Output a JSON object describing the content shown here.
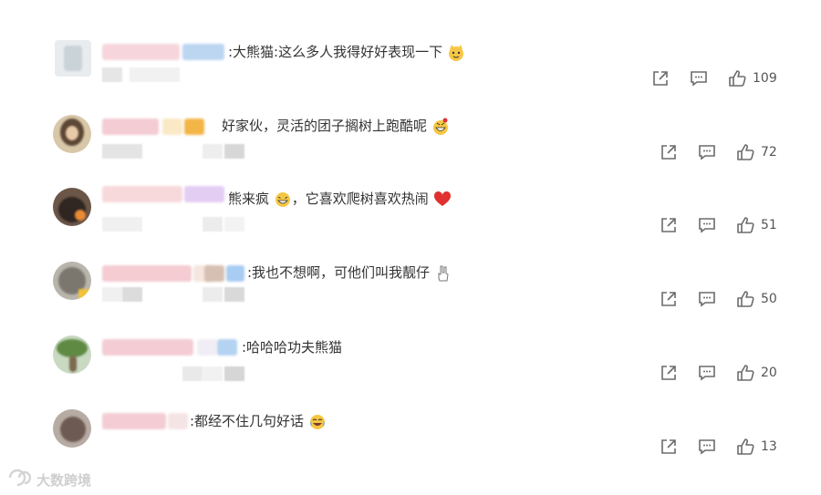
{
  "comments": [
    {
      "text": ":大熊猫:这么多人我得好好表现一下",
      "emoji": "cat-face",
      "likes": "109"
    },
    {
      "text": "好家伙，灵活的团子搁树上跑酷呢",
      "emoji": "grin-face",
      "likes": "72"
    },
    {
      "text": "熊来疯",
      "text2": "，它喜欢爬树喜欢热闹",
      "emoji": "laugh-face",
      "emoji2": "heart",
      "likes": "51"
    },
    {
      "text": ":我也不想啊，可他们叫我靓仔",
      "emoji": "peace-hand",
      "likes": "50"
    },
    {
      "text": ":哈哈哈功夫熊猫",
      "likes": "20"
    },
    {
      "text": ":都经不住几句好话",
      "emoji": "tears-face",
      "likes": "13"
    }
  ],
  "colors": {
    "heart": "#e0302f",
    "emoji_yellow": "#f6c744",
    "icon_gray": "#6b6b6b"
  },
  "watermark": "大数跨境"
}
